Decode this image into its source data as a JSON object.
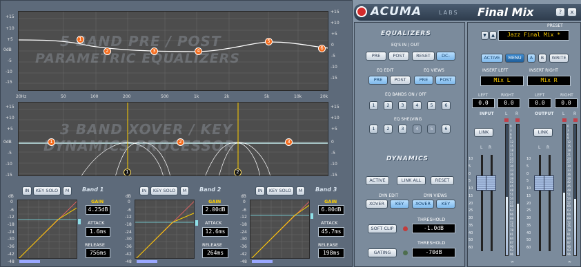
{
  "eq_graph": {
    "watermark_line1": "5 BAND PRE / POST",
    "watermark_line2": "PARAMETRIC EQUALIZERS",
    "y_ticks": [
      "+15",
      "+10",
      "+5",
      "0dB",
      "-5",
      "-10",
      "-15"
    ],
    "y_ticks_right": [
      "+15",
      "+10",
      "+5",
      "0",
      "-5",
      "-10",
      "-15"
    ],
    "x_ticks": [
      "20Hz",
      "50",
      "100",
      "200",
      "500",
      "1k",
      "2k",
      "5k",
      "10k",
      "20k"
    ],
    "nodes": [
      "1",
      "2",
      "3",
      "4",
      "5",
      "6"
    ]
  },
  "xover_graph": {
    "watermark_line1": "3 BAND XOVER / KEY",
    "watermark_line2": "DYNAMICS PROCESSOR",
    "y_ticks": [
      "+15",
      "+10",
      "+5",
      "0dB",
      "-5",
      "-10",
      "-15"
    ],
    "y_ticks_right": [
      "+15",
      "+10",
      "+5",
      "0",
      "-5",
      "-10",
      "-15"
    ],
    "band_nodes": [
      "1",
      "2",
      "3"
    ],
    "key_nodes": [
      "1",
      "2"
    ]
  },
  "bands": [
    {
      "title": "Band 1",
      "in": "IN",
      "key_solo": "KEY SOLO",
      "m": "M",
      "gain_label": "GAIN",
      "gain": "4.25dB",
      "attack_label": "ATTACK",
      "attack": "1.6ms",
      "release_label": "RELEASE",
      "release": "756ms"
    },
    {
      "title": "Band 2",
      "in": "IN",
      "key_solo": "KEY SOLO",
      "m": "M",
      "gain_label": "GAIN",
      "gain": "2.00dB",
      "attack_label": "ATTACK",
      "attack": "12.6ms",
      "release_label": "RELEASE",
      "release": "264ms"
    },
    {
      "title": "Band 3",
      "in": "IN",
      "key_solo": "KEY SOLO",
      "m": "M",
      "gain_label": "GAIN",
      "gain": "6.00dB",
      "attack_label": "ATTACK",
      "attack": "45.7ms",
      "release_label": "RELEASE",
      "release": "198ms"
    }
  ],
  "band_y_ticks": [
    "dB",
    "0",
    "-6",
    "-12",
    "-18",
    "-24",
    "-30",
    "-36",
    "-42",
    "-48"
  ],
  "header": {
    "logo": "ACUMA",
    "labs": "LABS",
    "product": "Final Mix",
    "help": "?",
    "close": "x"
  },
  "equalizers": {
    "title": "EQUALIZERS",
    "eq_in_out": "EQ'S IN / OUT",
    "pre": "PRE",
    "post": "POST",
    "reset": "RESET",
    "dc": "DC-",
    "eq_edit": "EQ EDIT",
    "eq_views": "EQ VIEWS",
    "bands_on_off": "EQ BANDS ON / OFF",
    "band_buttons": [
      "1",
      "2",
      "3",
      "4",
      "5",
      "6"
    ],
    "eq_shelving": "EQ  SHELVING",
    "shelving_buttons": [
      "1",
      "2",
      "3",
      "4",
      "5",
      "6"
    ]
  },
  "dynamics": {
    "title": "DYNAMICS",
    "active": "ACTIVE",
    "link_all": "LINK ALL",
    "reset": "RESET",
    "dyn_edit": "DYN EDIT",
    "dyn_views": "DYN VIEWS",
    "xover": "XOVER",
    "key": "KEY",
    "threshold_label": "THRESHOLD",
    "soft_clip": "SOFT CLIP",
    "soft_clip_value": "-1.0dB",
    "gating": "GATING",
    "gating_value": "-70dB"
  },
  "preset": {
    "label": "PRESET",
    "name": "Jazz Final Mix *"
  },
  "controls": {
    "active": "ACTIVE",
    "menu": "MENU",
    "a": "A",
    "b": "B",
    "write": "WRITE"
  },
  "insert": {
    "left_label": "INSERT LEFT",
    "right_label": "INSERT RIGHT",
    "left_value": "Mix L",
    "right_value": "Mix R"
  },
  "meters": {
    "input": {
      "title": "INPUT",
      "left_label": "LEFT",
      "right_label": "RIGHT",
      "left": "0.0",
      "right": "0.0",
      "link": "LINK",
      "l": "L",
      "r": "R"
    },
    "output": {
      "title": "OUTPUT",
      "left_label": "LEFT",
      "right_label": "RIGHT",
      "left": "0.0",
      "right": "0.0",
      "link": "LINK",
      "l": "L",
      "r": "R"
    },
    "fader_scale": [
      "10",
      "5",
      "0",
      "5",
      "10",
      "15",
      "20",
      "25",
      "30",
      "35",
      "40",
      "50",
      "60"
    ],
    "meter_scale": [
      "0",
      "3",
      "6",
      "9",
      "12",
      "15",
      "18",
      "21",
      "24",
      "27",
      "30",
      "33",
      "36",
      "39",
      "42",
      "45",
      "48",
      "51",
      "54",
      "57",
      "60",
      "63",
      "66",
      "69",
      "72",
      "75",
      "78",
      "81",
      "84",
      "87",
      "90",
      "93",
      "96"
    ],
    "inf": "∞",
    "input_level": 0.45,
    "output_level": 0.48
  }
}
